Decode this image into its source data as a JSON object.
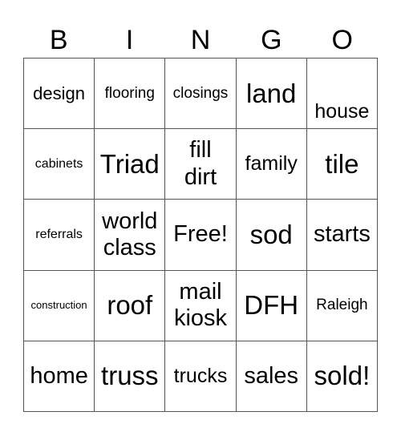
{
  "header": {
    "letters": [
      "B",
      "I",
      "N",
      "G",
      "O"
    ]
  },
  "cells": [
    [
      "design",
      "flooring",
      "closings",
      "land",
      "house"
    ],
    [
      "cabinets",
      "Triad",
      "fill\ndirt",
      "family",
      "tile"
    ],
    [
      "referrals",
      "world\nclass",
      "Free!",
      "sod",
      "starts"
    ],
    [
      "construction",
      "roof",
      "mail\nkiosk",
      "DFH",
      "Raleigh"
    ],
    [
      "home",
      "truss",
      "trucks",
      "sales",
      "sold!"
    ]
  ],
  "free_space": "Free!"
}
